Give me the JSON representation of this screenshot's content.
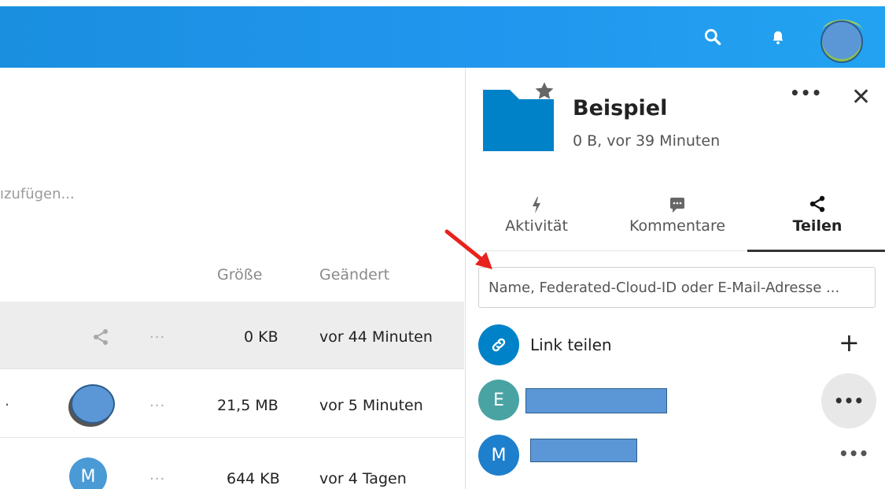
{
  "files": {
    "filter_hint": "ızufügen...",
    "columns": {
      "size": "Größe",
      "modified": "Geändert"
    },
    "rows": [
      {
        "size": "0 KB",
        "modified": "vor 44 Minuten"
      },
      {
        "size": "21,5 MB",
        "modified": "vor 5 Minuten",
        "prefix": "."
      },
      {
        "size": "644 KB",
        "modified": "vor 4 Tagen",
        "avatar": "M"
      }
    ],
    "dots": "..."
  },
  "sidebar": {
    "title": "Beispiel",
    "subtitle": "0 B, vor 39 Minuten",
    "more": "•••",
    "close": "✕",
    "tabs": [
      {
        "label": "Aktivität",
        "icon": "bolt-icon"
      },
      {
        "label": "Kommentare",
        "icon": "comment-icon"
      },
      {
        "label": "Teilen",
        "icon": "share-icon"
      }
    ],
    "share_input": {
      "placeholder": "Name, Federated-Cloud-ID oder E-Mail-Adresse ..."
    },
    "link_share": {
      "label": "Link teilen",
      "add": "+"
    },
    "shares": [
      {
        "initial": "E",
        "color": "#4aa3a3"
      },
      {
        "initial": "M",
        "color": "#1e7fcc"
      }
    ],
    "menu_dots": "•••"
  },
  "colors": {
    "header": "#1a8fe0",
    "accent": "#0082c9",
    "folder": "#0082c9",
    "arrow": "#e8221c"
  }
}
